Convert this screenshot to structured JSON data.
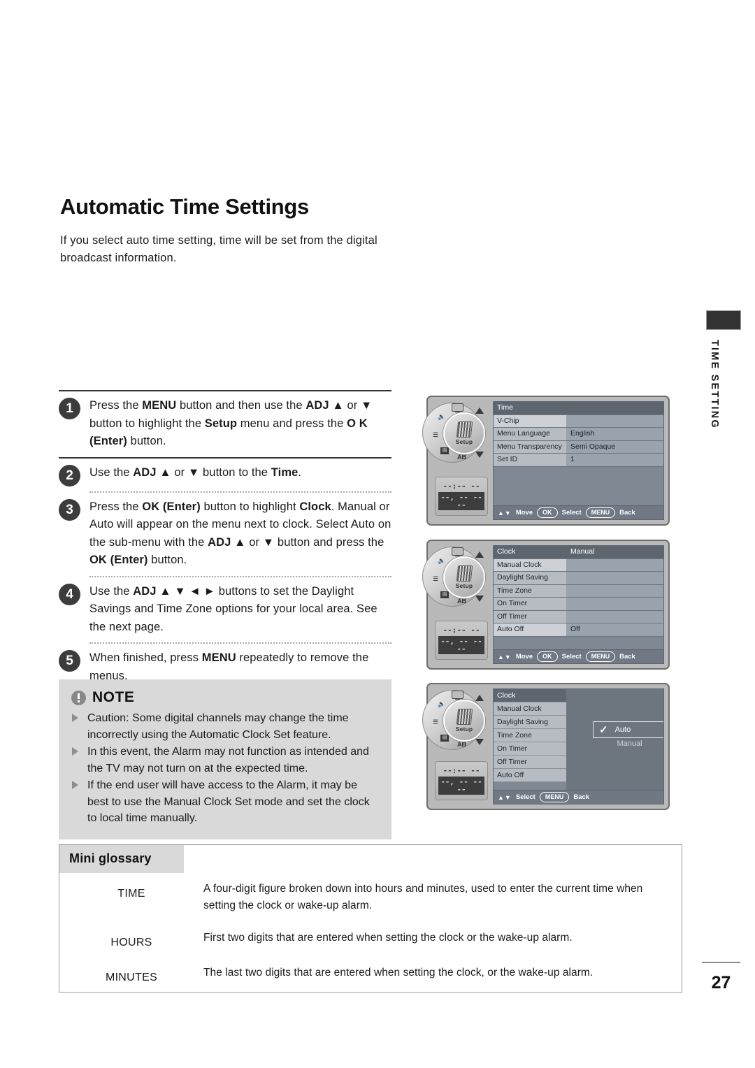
{
  "page": {
    "title": "Automatic Time Settings",
    "intro": "If you select auto time setting, time will be set from the digital broadcast information.",
    "number": "27",
    "margin_label": "TIME SETTING"
  },
  "steps": [
    {
      "num": "1",
      "html": "Press the <b>MENU</b> button and then use the <b>ADJ</b> ▲ or ▼ button to highlight the <b>Setup</b> menu and press the <b>O K</b> <b>(Enter)</b> button."
    },
    {
      "num": "2",
      "html": "Use the <b>ADJ</b> ▲ or ▼ button to the <b>Time</b>."
    },
    {
      "num": "3",
      "html": "Press the <b>OK (Enter)</b> button to highlight <b>Clock</b>. Manual or Auto will appear on the menu next to clock. Select Auto on the sub-menu with the <b>ADJ</b> ▲ or ▼ button and press the <b>OK (Enter)</b> button."
    },
    {
      "num": "4",
      "html": "Use the <b>ADJ</b> ▲ ▼ ◄ ► buttons to set the Daylight Savings and Time Zone options for your local area. See the next page."
    },
    {
      "num": "5",
      "html": "When finished, press <b>MENU</b> repeatedly to remove the menus."
    }
  ],
  "note": {
    "title": "NOTE",
    "items": [
      "Caution: Some digital channels may change the time incorrectly using the Automatic Clock Set feature.",
      "In this event, the Alarm may not function as intended and the TV may not turn on at the expected time.",
      "If the end user will have access to the Alarm, it may be best to use the Manual Clock Set mode and set the clock to local time manually."
    ]
  },
  "glossary": {
    "heading": "Mini glossary",
    "rows": [
      {
        "term": "TIME",
        "definition": "A four-digit figure broken down into hours and minutes, used to enter the current time when setting the clock or wake-up alarm."
      },
      {
        "term": "HOURS",
        "definition": "First two digits that are entered when setting the clock or the wake-up alarm."
      },
      {
        "term": "MINUTES",
        "definition": "The last two digits that are entered when setting the clock, or the wake-up alarm."
      }
    ]
  },
  "tv_panels": {
    "setup_label": "Setup",
    "ab_label": "AB",
    "led_line1": "--:-- --",
    "led_line2": "--, -- ----",
    "panel1": {
      "rows": [
        {
          "label": "Time",
          "value": "",
          "selected": true,
          "caret": true
        },
        {
          "label": "V-Chip",
          "value": "",
          "selected": false,
          "caret": false
        },
        {
          "label": "Menu Language",
          "value": "English",
          "selected": false,
          "caret": false
        },
        {
          "label": "Menu Transparency",
          "value": "Semi Opaque",
          "selected": false,
          "caret": false
        },
        {
          "label": "Set ID",
          "value": "1",
          "selected": false,
          "caret": false
        }
      ],
      "bar": {
        "move": "Move",
        "ok": "OK",
        "select": "Select",
        "menu": "MENU",
        "back": "Back"
      }
    },
    "panel2": {
      "rows": [
        {
          "label": "Clock",
          "value": "Manual",
          "selected": true,
          "caret": true
        },
        {
          "label": "Manual Clock",
          "value": "",
          "selected": false,
          "caret": false
        },
        {
          "label": "Daylight Saving",
          "value": "",
          "selected": false,
          "caret": false
        },
        {
          "label": "Time Zone",
          "value": "",
          "selected": false,
          "caret": false
        },
        {
          "label": "On Timer",
          "value": "",
          "selected": false,
          "caret": false
        },
        {
          "label": "Off Timer",
          "value": "",
          "selected": false,
          "caret": false
        },
        {
          "label": "Auto Off",
          "value": "Off",
          "selected": false,
          "caret": false
        }
      ],
      "bar": {
        "move": "Move",
        "ok": "OK",
        "select": "Select",
        "menu": "MENU",
        "back": "Back"
      }
    },
    "panel3": {
      "rows": [
        {
          "label": "Clock",
          "selected": true
        },
        {
          "label": "Manual Clock",
          "selected": false
        },
        {
          "label": "Daylight Saving",
          "selected": false
        },
        {
          "label": "Time Zone",
          "selected": false
        },
        {
          "label": "On Timer",
          "selected": false
        },
        {
          "label": "Off Timer",
          "selected": false
        },
        {
          "label": "Auto Off",
          "selected": false
        }
      ],
      "popup": {
        "checked_option": "Auto",
        "other_option": "Manual",
        "check_glyph": "✓"
      },
      "bar": {
        "select": "Select",
        "menu": "MENU",
        "back": "Back"
      }
    }
  }
}
